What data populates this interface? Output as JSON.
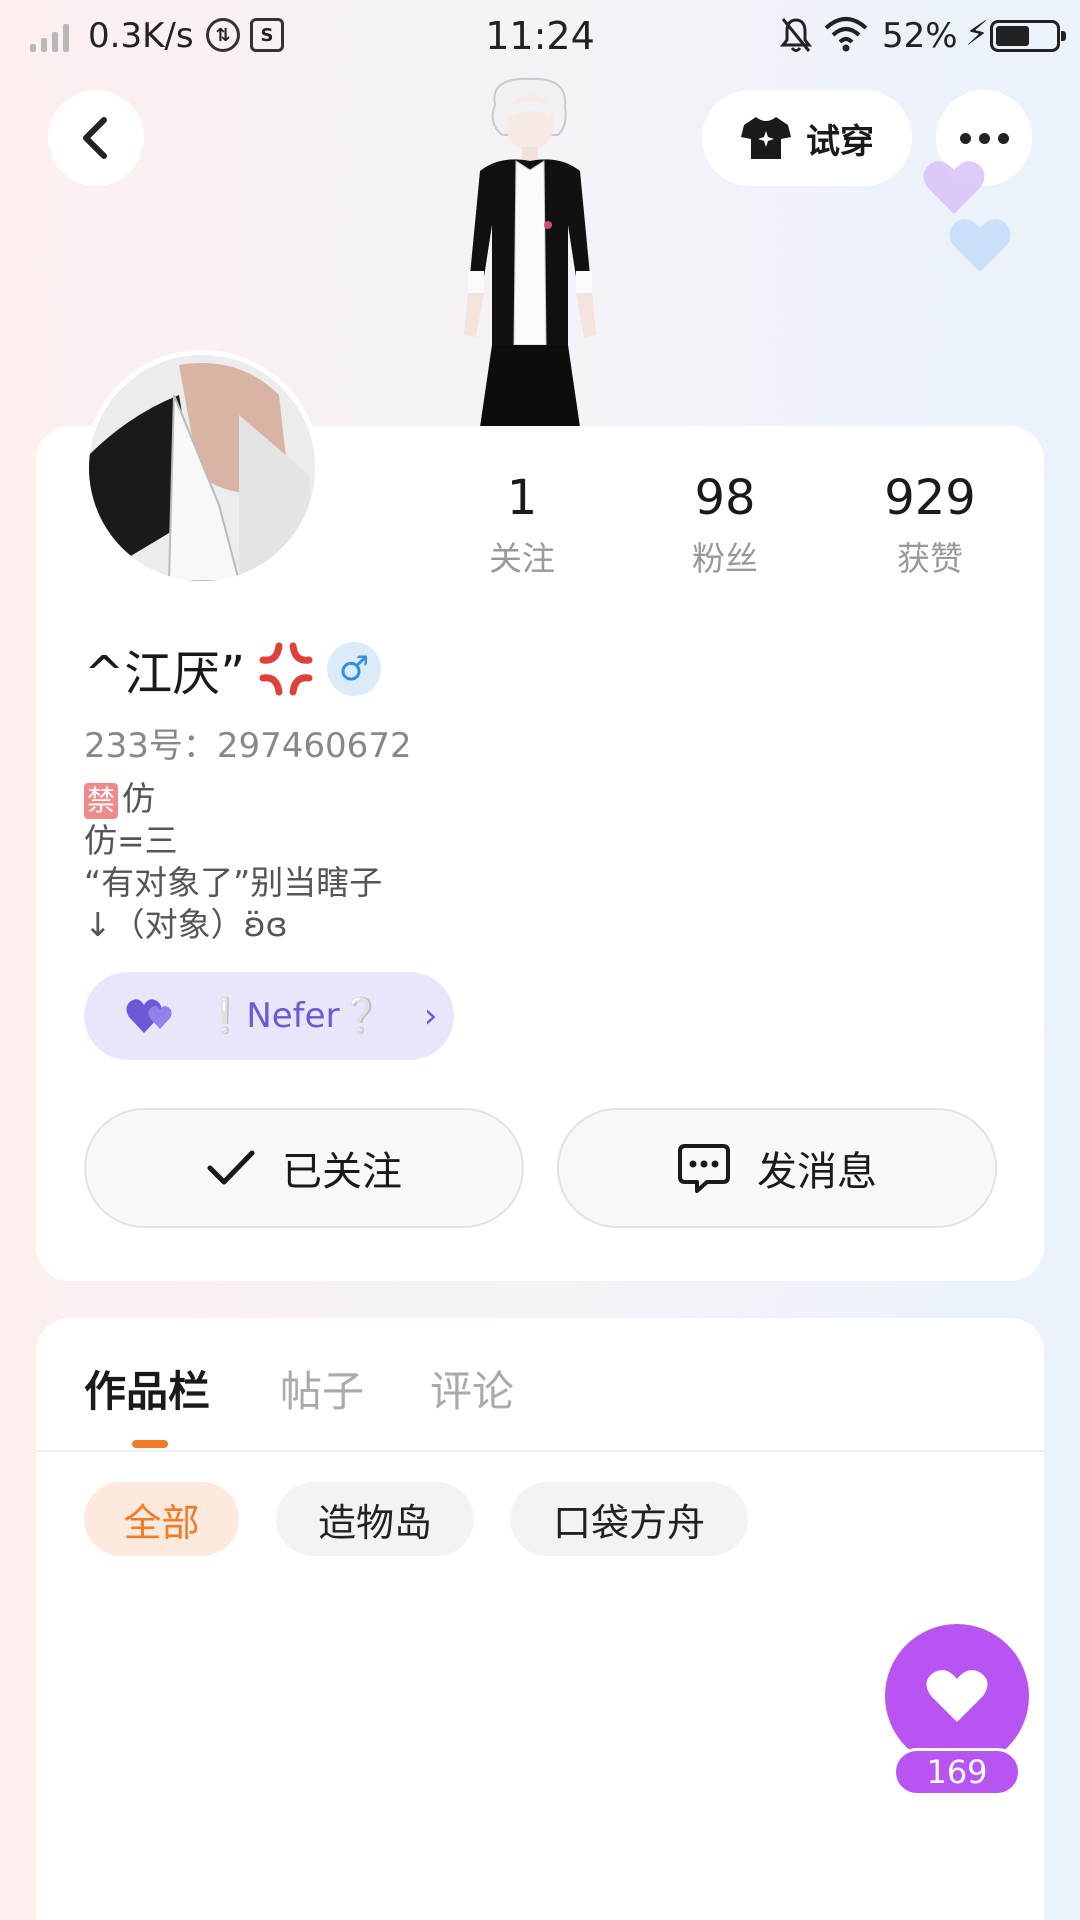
{
  "status_bar": {
    "net_speed": "0.3K/s",
    "time": "11:24",
    "battery": "52%"
  },
  "header": {
    "try_on_label": "试穿"
  },
  "profile": {
    "stats": [
      {
        "value": "1",
        "label": "关注"
      },
      {
        "value": "98",
        "label": "粉丝"
      },
      {
        "value": "929",
        "label": "获赞"
      }
    ],
    "username": "^江厌”",
    "uid": "233号：297460672",
    "bio_tag": "禁",
    "bio_lines": [
      "仿",
      "仿=三",
      "“有对象了”别当瞎子",
      "↓（对象）ʚ̈ɞ"
    ],
    "partner_name": "❕Nefer❔",
    "follow_label": "已关注",
    "message_label": "发消息"
  },
  "tabs": [
    "作品栏",
    "帖子",
    "评论"
  ],
  "filters": [
    "全部",
    "造物岛",
    "口袋方舟"
  ],
  "likes": {
    "count": "169"
  },
  "colors": {
    "accent_orange": "#f27b25",
    "like_purple": "#b854f2",
    "partner_purple": "#6a5ad8"
  }
}
